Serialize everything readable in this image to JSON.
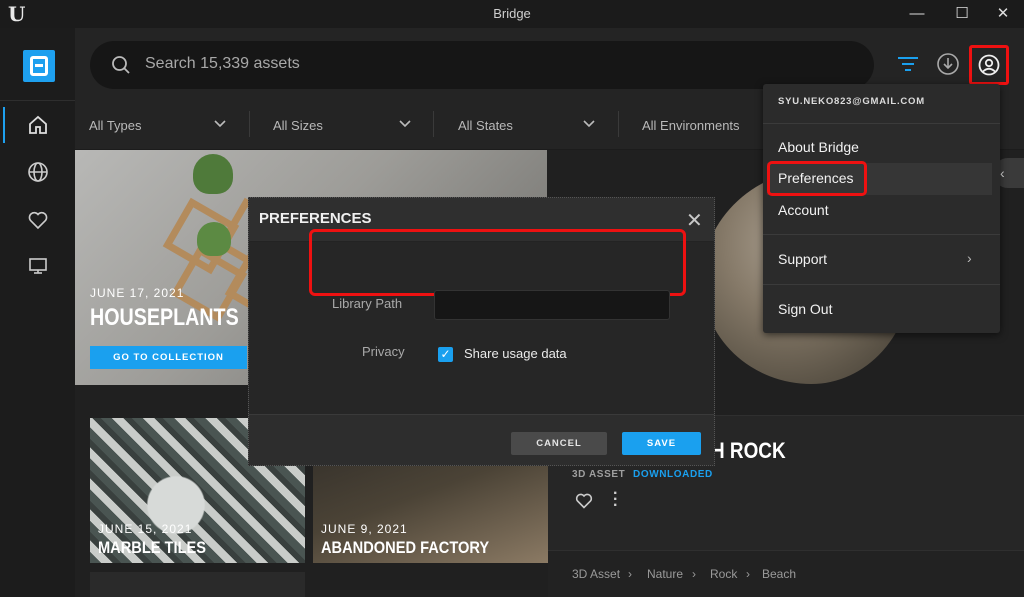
{
  "window": {
    "title": "Bridge"
  },
  "search": {
    "placeholder": "Search 15,339 assets"
  },
  "filters": [
    {
      "label": "All Types"
    },
    {
      "label": "All Sizes"
    },
    {
      "label": "All States"
    },
    {
      "label": "All Environments"
    }
  ],
  "hero": {
    "date": "JUNE 17, 2021",
    "title": "HOUSEPLANTS",
    "cta": "GO TO COLLECTION"
  },
  "tiles": [
    {
      "date": "JUNE 15, 2021",
      "title": "MARBLE TILES"
    },
    {
      "date": "JUNE 9, 2021",
      "title": "ABANDONED FACTORY"
    }
  ],
  "asset": {
    "name_visible": "H ROCK",
    "type": "3D ASSET",
    "status": "DOWNLOADED",
    "breadcrumb": [
      "3D Asset",
      "Nature",
      "Rock",
      "Beach"
    ]
  },
  "account_menu": {
    "email": "SYU.NEKO823@GMAIL.COM",
    "items": [
      "About Bridge",
      "Preferences",
      "Account",
      "Support",
      "Sign Out"
    ]
  },
  "preferences": {
    "title": "PREFERENCES",
    "library_path_label": "Library Path",
    "library_path_value": "",
    "privacy_label": "Privacy",
    "share_usage_label": "Share usage data",
    "share_usage_checked": true,
    "cancel_label": "CANCEL",
    "save_label": "SAVE"
  },
  "colors": {
    "accent": "#1aa0ef",
    "highlight": "#ee1111",
    "background": "#202020"
  },
  "icons": {
    "rail": [
      "home-icon",
      "globe-icon",
      "heart-icon",
      "monitor-icon"
    ],
    "header": [
      "filter-icon",
      "download-icon",
      "user-circle-icon"
    ]
  }
}
